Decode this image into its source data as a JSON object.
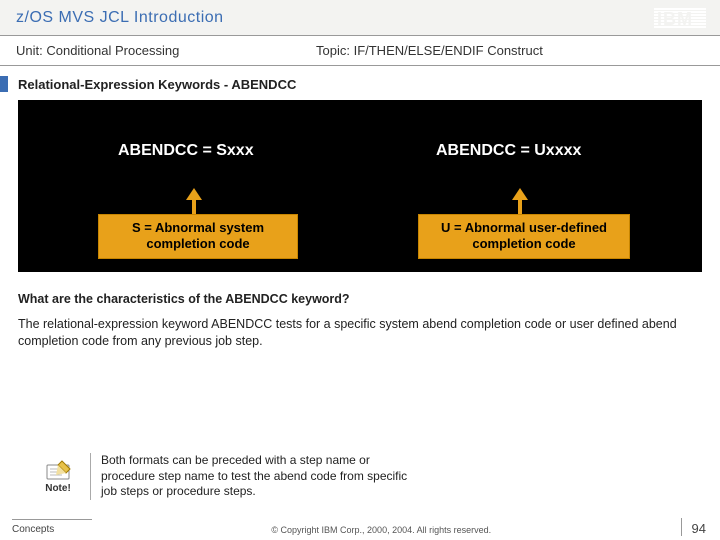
{
  "header": {
    "title": "z/OS MVS JCL Introduction",
    "logo_label": "IBM"
  },
  "subheader": {
    "unit_prefix": "Unit: ",
    "unit": "Conditional Processing",
    "topic_prefix": "Topic: ",
    "topic": "IF/THEN/ELSE/ENDIF Construct"
  },
  "section_title": "Relational-Expression Keywords - ABENDCC",
  "panel": {
    "left_head": "ABENDCC = Sxxx",
    "right_head": "ABENDCC = Uxxxx",
    "left_box": "S = Abnormal system completion code",
    "right_box": "U = Abnormal user-defined completion code"
  },
  "question": "What are the characteristics of the ABENDCC keyword?",
  "body": "The relational-expression keyword ABENDCC tests for a specific system abend completion code or user defined abend completion code from any previous job step.",
  "note": {
    "label": "Note!",
    "text": "Both formats can be preceded with a step name or procedure step name to test the abend code from specific job steps or procedure steps."
  },
  "footer": {
    "left": "Concepts",
    "copyright": "© Copyright IBM Corp., 2000, 2004. All rights reserved.",
    "page": "94"
  }
}
